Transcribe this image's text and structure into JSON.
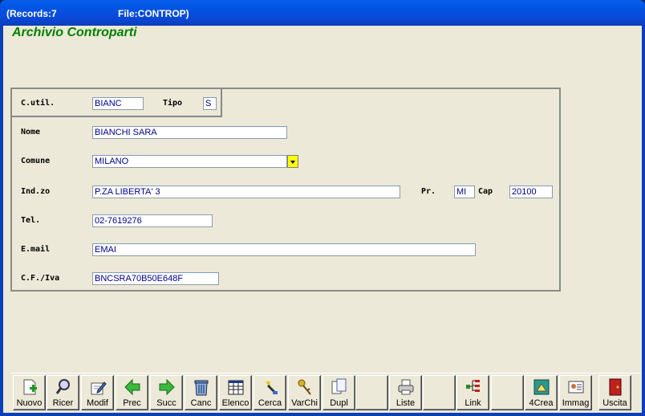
{
  "window": {
    "records_text": "(Records:7",
    "file_text": "File:CONTROP)"
  },
  "app": {
    "title": "Archivio Controparti"
  },
  "form": {
    "cutil": {
      "label": "C.util.",
      "value": "BIANC"
    },
    "tipo": {
      "label": "Tipo",
      "value": "S"
    },
    "nome": {
      "label": "Nome",
      "value": "BIANCHI SARA"
    },
    "comune": {
      "label": "Comune",
      "value": "MILANO"
    },
    "indirizzo": {
      "label": "Ind.zo",
      "value": "P.ZA LIBERTA' 3"
    },
    "provincia": {
      "label": "Pr.",
      "value": "MI"
    },
    "cap": {
      "label": "Cap",
      "value": "20100"
    },
    "tel": {
      "label": "Tel.",
      "value": "02-7619276"
    },
    "email": {
      "label": "E.mail",
      "value": "EMAI"
    },
    "cfiva": {
      "label": "C.F./Iva",
      "value": "BNCSRA70B50E648F"
    }
  },
  "toolbar": {
    "buttons": [
      {
        "label": "Nuovo",
        "icon": "new-document-icon"
      },
      {
        "label": "Ricer",
        "icon": "search-icon"
      },
      {
        "label": "Modif",
        "icon": "edit-icon"
      },
      {
        "label": "Prec",
        "icon": "arrow-left-icon"
      },
      {
        "label": "Succ",
        "icon": "arrow-right-icon"
      },
      {
        "label": "Canc",
        "icon": "trash-icon"
      },
      {
        "label": "Elenco",
        "icon": "list-icon"
      },
      {
        "label": "Cerca",
        "icon": "find-wand-icon"
      },
      {
        "label": "VarChi",
        "icon": "keys-icon"
      },
      {
        "label": "Dupl",
        "icon": "duplicate-icon"
      },
      {
        "label": "",
        "icon": ""
      },
      {
        "label": "Liste",
        "icon": "printer-icon"
      },
      {
        "label": "",
        "icon": ""
      },
      {
        "label": "Link",
        "icon": "link-tree-icon"
      },
      {
        "label": "",
        "icon": ""
      },
      {
        "label": "4Crea",
        "icon": "create-icon"
      },
      {
        "label": "Immag",
        "icon": "image-card-icon"
      },
      {
        "label": "",
        "icon": ""
      },
      {
        "label": "Uscita",
        "icon": "exit-door-icon"
      }
    ]
  },
  "colors": {
    "title_green": "#008000",
    "field_text": "#00008b",
    "dropdown_yellow": "#ffff00",
    "titlebar_blue": "#0a48d8"
  }
}
